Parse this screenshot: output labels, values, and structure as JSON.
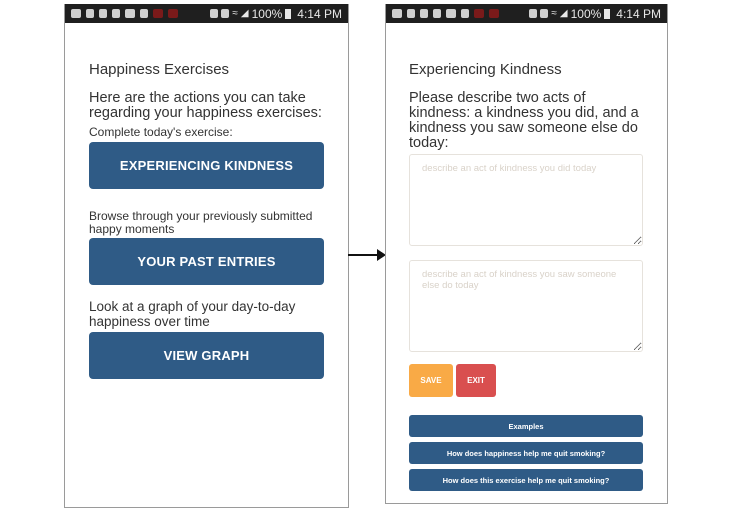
{
  "status_bar": {
    "battery": "100%",
    "time": "4:14 PM",
    "icons": [
      "message-icon",
      "phone-outline-icon",
      "wrench-icon",
      "image-icon",
      "shield-wifi-icon",
      "download-icon",
      "red-app-icon",
      "red-app-icon",
      "nfc-icon",
      "mute-icon",
      "wifi-icon",
      "signal-icon",
      "battery-icon"
    ]
  },
  "left_screen": {
    "title": "Happiness Exercises",
    "intro": "Here are the actions you can take regarding your happiness exercises:",
    "sections": [
      {
        "label": "Complete today's exercise:",
        "button": "EXPERIENCING KINDNESS"
      },
      {
        "label": "Browse through your previously submitted happy moments",
        "button": "YOUR PAST ENTRIES"
      },
      {
        "label": "Look at a graph of your day-to-day happiness over time",
        "button": "VIEW GRAPH"
      }
    ]
  },
  "right_screen": {
    "title": "Experiencing Kindness",
    "prompt": "Please describe two acts of kindness: a kindness you did, and a kindness you saw someone else do today:",
    "field1": {
      "value": "",
      "placeholder": "describe an act of kindness you did today"
    },
    "field2": {
      "value": "",
      "placeholder": "describe an act of kindness you saw someone else do today"
    },
    "save_label": "SAVE",
    "exit_label": "EXIT",
    "info_buttons": [
      "Examples",
      "How does happiness help me quit smoking?",
      "How does this exercise help me quit smoking?"
    ]
  },
  "colors": {
    "primary": "#2f5b86",
    "save": "#f9aa46",
    "exit": "#d94f4f",
    "status_bar": "#1f1f1f"
  }
}
